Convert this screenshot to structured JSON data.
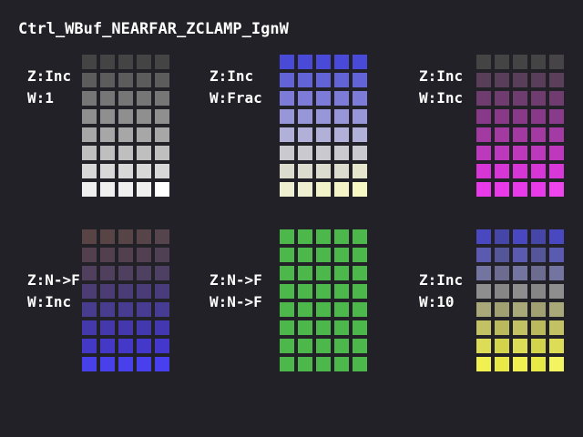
{
  "title": "Ctrl_WBuf_NEARFAR_ZCLAMP_IgnW",
  "panels": [
    {
      "id": "panel-1",
      "z_label": "Z:Inc",
      "w_label": "W:1",
      "colors": [
        [
          "#444444",
          "#444444",
          "#444444",
          "#444444",
          "#444444"
        ],
        [
          "#5c5c5c",
          "#5c5c5c",
          "#5c5c5c",
          "#5c5c5c",
          "#5c5c5c"
        ],
        [
          "#767676",
          "#767676",
          "#767676",
          "#767676",
          "#767676"
        ],
        [
          "#8f8f8f",
          "#8f8f8f",
          "#8f8f8f",
          "#8f8f8f",
          "#8f8f8f"
        ],
        [
          "#a7a7a7",
          "#a7a7a7",
          "#a7a7a7",
          "#a7a7a7",
          "#a7a7a7"
        ],
        [
          "#bfbfbf",
          "#bfbfbf",
          "#bfbfbf",
          "#bfbfbf",
          "#bfbfbf"
        ],
        [
          "#d8d8d8",
          "#d8d8d8",
          "#d8d8d8",
          "#d8d8d8",
          "#d8d8d8"
        ],
        [
          "#efefef",
          "#efefef",
          "#efefef",
          "#efefef",
          "#ffffff"
        ]
      ]
    },
    {
      "id": "panel-2",
      "z_label": "Z:Inc",
      "w_label": "W:Frac",
      "colors": [
        [
          "#4a4ad8",
          "#4a4ad8",
          "#4a4ad8",
          "#4a4ad8",
          "#4a4ad8"
        ],
        [
          "#6363d8",
          "#6363d8",
          "#6363d8",
          "#6363d8",
          "#6363d8"
        ],
        [
          "#7c7cd8",
          "#7c7cd8",
          "#7c7cd8",
          "#7c7cd8",
          "#7c7cd8"
        ],
        [
          "#9696d8",
          "#9696d8",
          "#9696d8",
          "#9696d8",
          "#9696d8"
        ],
        [
          "#b0b0d8",
          "#b0b0d8",
          "#b0b0d8",
          "#b0b0d8",
          "#b0b0d8"
        ],
        [
          "#c9c9cf",
          "#c9c9cf",
          "#c9c9cf",
          "#c9c9cf",
          "#c9c9cf"
        ],
        [
          "#dcdcce",
          "#dcdcce",
          "#dcdcce",
          "#dcdcce",
          "#e6e6cc"
        ],
        [
          "#eeeed0",
          "#eeeed0",
          "#f2f2c8",
          "#f4f4c6",
          "#f8f8c4"
        ]
      ]
    },
    {
      "id": "panel-3",
      "z_label": "Z:Inc",
      "w_label": "W:Inc",
      "colors": [
        [
          "#444444",
          "#444444",
          "#444444",
          "#444444",
          "#464446"
        ],
        [
          "#583e58",
          "#583e58",
          "#583e58",
          "#583e58",
          "#5a3e5a"
        ],
        [
          "#6e3c6e",
          "#6e3c6e",
          "#6e3c6e",
          "#6e3c6e",
          "#703c70"
        ],
        [
          "#883a88",
          "#883a88",
          "#883a88",
          "#883a88",
          "#8a3a8a"
        ],
        [
          "#a23aa2",
          "#a23aa2",
          "#a23aa2",
          "#a23aa2",
          "#a43aa4"
        ],
        [
          "#bc38bc",
          "#bc38bc",
          "#bc38bc",
          "#bc38bc",
          "#be38be"
        ],
        [
          "#d636d6",
          "#d636d6",
          "#d636d6",
          "#d636d6",
          "#d838d8"
        ],
        [
          "#e83ae8",
          "#e83ae8",
          "#e83ae8",
          "#e83ae8",
          "#ee44ee"
        ]
      ]
    },
    {
      "id": "panel-4",
      "z_label": "Z:N->F",
      "w_label": "W:Inc",
      "colors": [
        [
          "#584444",
          "#584444",
          "#574447",
          "#564449",
          "#55444b"
        ],
        [
          "#53404f",
          "#53404f",
          "#52404f",
          "#514051",
          "#504053"
        ],
        [
          "#50405d",
          "#50405d",
          "#4f405f",
          "#4e4061",
          "#4d4063"
        ],
        [
          "#4b3c74",
          "#4b3c74",
          "#4a3c76",
          "#4a3c78",
          "#493c7a"
        ],
        [
          "#483c8e",
          "#483c8e",
          "#473c90",
          "#473c92",
          "#463c94"
        ],
        [
          "#4538aa",
          "#4538aa",
          "#4538ac",
          "#4438ae",
          "#4438b0"
        ],
        [
          "#4438c6",
          "#4438c6",
          "#4438c8",
          "#4438ca",
          "#4438cc"
        ],
        [
          "#4840e8",
          "#4840e8",
          "#4840ea",
          "#4840ec",
          "#4840ee"
        ]
      ]
    },
    {
      "id": "panel-5",
      "z_label": "Z:N->F",
      "w_label": "W:N->F",
      "colors": [
        [
          "#4cb84c",
          "#4cb84c",
          "#4cb84c",
          "#4cb84c",
          "#4cb84c"
        ],
        [
          "#4cb84c",
          "#4cb84c",
          "#4cb84c",
          "#4cb84c",
          "#4cb84c"
        ],
        [
          "#4cb84c",
          "#4cb84c",
          "#4cb84c",
          "#4cb84c",
          "#4cb84c"
        ],
        [
          "#4cb84c",
          "#4cb84c",
          "#4cb84c",
          "#4cb84c",
          "#4cb84c"
        ],
        [
          "#4cb84c",
          "#4cb84c",
          "#4cb84c",
          "#4cb84c",
          "#4cb84c"
        ],
        [
          "#4cb84c",
          "#4cb84c",
          "#4cb84c",
          "#4cb84c",
          "#4cb84c"
        ],
        [
          "#4cb84c",
          "#4cb84c",
          "#4cb84c",
          "#4cb84c",
          "#4cb84c"
        ],
        [
          "#4cb84c",
          "#4cb84c",
          "#4cb84c",
          "#4cb84c",
          "#4cb84c"
        ]
      ]
    },
    {
      "id": "panel-6",
      "z_label": "Z:Inc",
      "w_label": "W:10",
      "colors": [
        [
          "#4a48c0",
          "#4646a8",
          "#4a48c0",
          "#4646a8",
          "#4a48c0"
        ],
        [
          "#5a5ab0",
          "#55559a",
          "#5a5ab0",
          "#55559a",
          "#5a5ab0"
        ],
        [
          "#7474a0",
          "#6c6c90",
          "#7474a0",
          "#6c6c90",
          "#7474a0"
        ],
        [
          "#8e8e8e",
          "#868686",
          "#8e8e8e",
          "#868686",
          "#8e8e8e"
        ],
        [
          "#a8a878",
          "#a0a070",
          "#a8a878",
          "#a0a070",
          "#a8a878"
        ],
        [
          "#c2c264",
          "#baba5c",
          "#c2c264",
          "#baba5c",
          "#c2c264"
        ],
        [
          "#dcdc56",
          "#d4d44c",
          "#dcdc56",
          "#d4d44c",
          "#dcdc56"
        ],
        [
          "#f0f050",
          "#e8e846",
          "#f0f050",
          "#e8e846",
          "#f4f460"
        ]
      ]
    }
  ]
}
